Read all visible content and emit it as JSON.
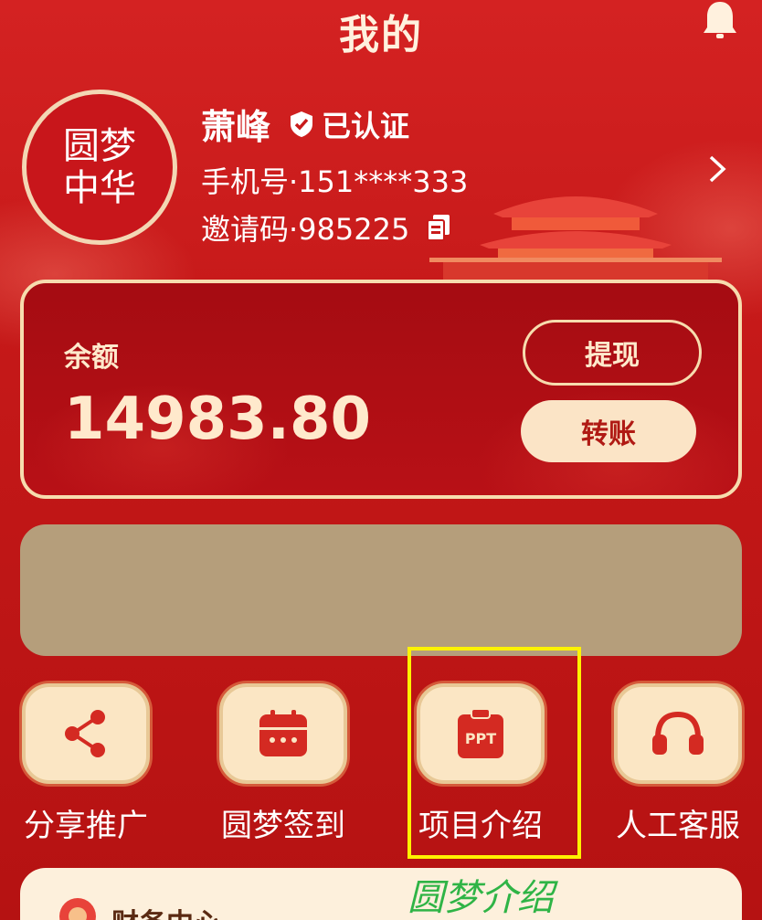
{
  "header": {
    "title": "我的"
  },
  "profile": {
    "avatar_text": "圆梦中华",
    "name": "萧峰",
    "verified_label": "已认证",
    "phone": "手机号·151****333",
    "invite_code": "邀请码·985225"
  },
  "balance": {
    "label": "余额",
    "value": "14983.80",
    "withdraw_label": "提现",
    "transfer_label": "转账"
  },
  "menu": {
    "items": [
      {
        "label": "分享推广",
        "icon": "share-icon"
      },
      {
        "label": "圆梦签到",
        "icon": "calendar-icon"
      },
      {
        "label": "项目介绍",
        "icon": "ppt-icon"
      },
      {
        "label": "人工客服",
        "icon": "headset-icon"
      }
    ]
  },
  "annotation": {
    "caption": "圆梦介绍"
  },
  "finance": {
    "title": "财务中心"
  },
  "colors": {
    "background": "#c81a1a",
    "accent_gold": "#f7dcae",
    "highlight": "#fff200",
    "caption_green": "#2fb446",
    "banner": "#b59e7b"
  }
}
